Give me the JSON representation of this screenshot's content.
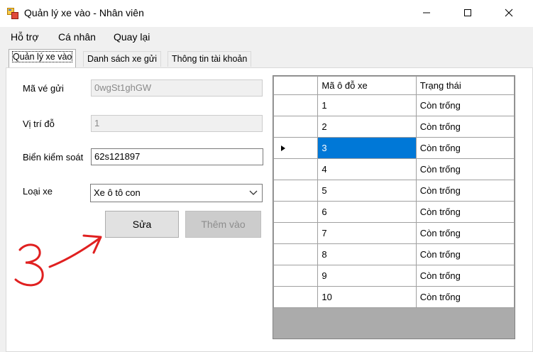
{
  "window": {
    "title": "Quản lý xe vào - Nhân viên",
    "icon": "app-window-icon",
    "controls": [
      "minimize-icon",
      "maximize-icon",
      "close-icon"
    ]
  },
  "menu": {
    "items": [
      "Hỗ trợ",
      "Cá nhân",
      "Quay lại"
    ]
  },
  "tabs": [
    {
      "label": "Quản lý xe vào",
      "active": true
    },
    {
      "label": "Danh sách xe gửi",
      "active": false
    },
    {
      "label": "Thông tin tài khoản",
      "active": false
    }
  ],
  "form": {
    "ticket_label": "Mã vé gửi",
    "ticket_value": "0wgSt1ghGW",
    "position_label": "Vị trí đỗ",
    "position_value": "1",
    "plate_label": "Biển kiểm soát",
    "plate_value": "62s121897",
    "type_label": "Loại xe",
    "type_value": "Xe ô tô con",
    "edit_button": "Sửa",
    "add_button": "Thêm vào"
  },
  "grid": {
    "headers": [
      "Mã ô đỗ xe",
      "Trạng thái"
    ],
    "selected_row": 2,
    "rows": [
      {
        "id": "1",
        "status": "Còn trống"
      },
      {
        "id": "2",
        "status": "Còn trống"
      },
      {
        "id": "3",
        "status": "Còn trống"
      },
      {
        "id": "4",
        "status": "Còn trống"
      },
      {
        "id": "5",
        "status": "Còn trống"
      },
      {
        "id": "6",
        "status": "Còn trống"
      },
      {
        "id": "7",
        "status": "Còn trống"
      },
      {
        "id": "8",
        "status": "Còn trống"
      },
      {
        "id": "9",
        "status": "Còn trống"
      },
      {
        "id": "10",
        "status": "Còn trống"
      }
    ]
  },
  "annotation": {
    "text": "3",
    "color": "#e02020"
  },
  "colors": {
    "selection": "#0078d7",
    "grid_background": "#ababab",
    "window_background": "#f0f0f0"
  }
}
